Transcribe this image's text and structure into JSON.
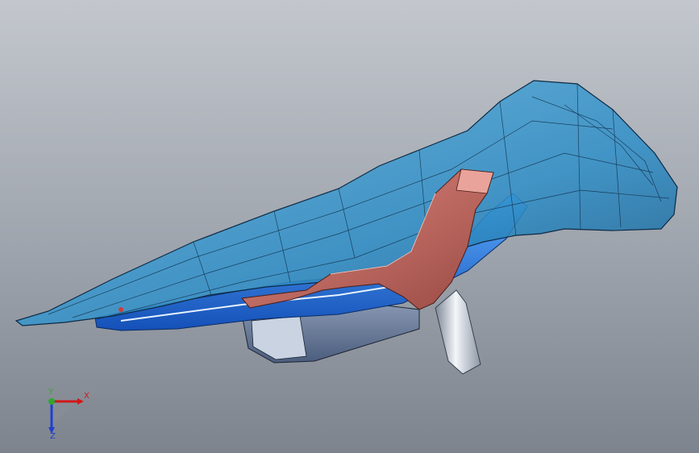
{
  "viewport": {
    "background_top": "#c3c7cd",
    "background_bottom": "#7e848d"
  },
  "model": {
    "shell_color": "#2f8fc8",
    "frame_color": "#1f6fd0",
    "bracket_color": "#b7625b",
    "bracket_top_color": "#e08a80",
    "mount_color": "#6a7fa0",
    "arm_color": "#d8dde6"
  },
  "triad": {
    "x_label": "X",
    "y_label": "Y",
    "z_label": "Z",
    "x_color": "#d11818",
    "y_color": "#2fa82f",
    "z_color": "#1f3fd0"
  }
}
